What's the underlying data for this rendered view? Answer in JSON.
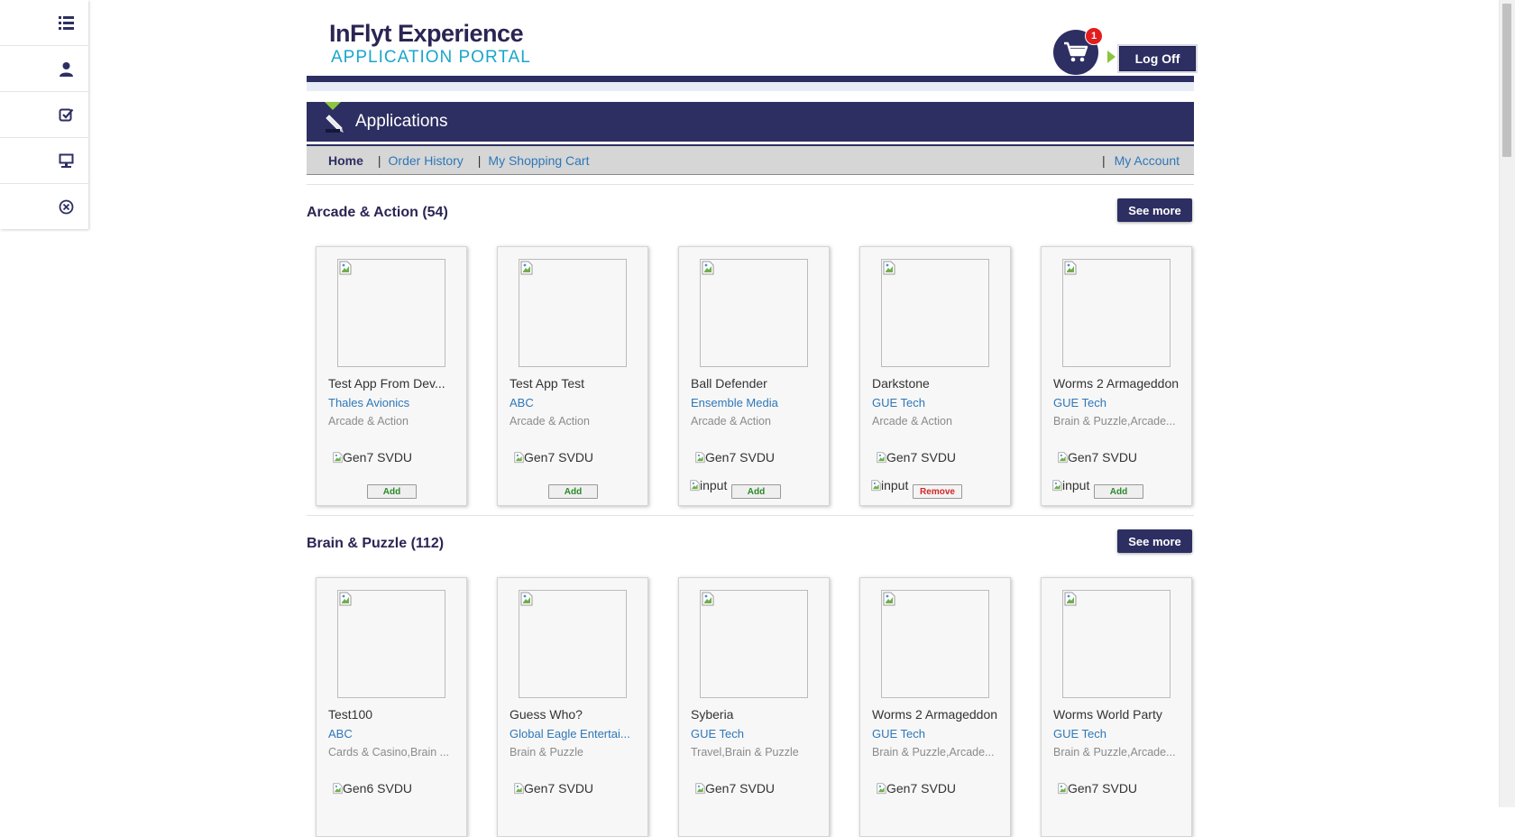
{
  "sidenav": {
    "items": [
      {
        "icon": "list-icon"
      },
      {
        "icon": "user-icon"
      },
      {
        "icon": "checkbox-icon"
      },
      {
        "icon": "monitor-icon"
      },
      {
        "icon": "close-circle-icon"
      }
    ]
  },
  "header": {
    "title": "InFlyt Experience",
    "subtitle": "APPLICATION PORTAL",
    "cart_count": "1",
    "logoff_label": "Log Off"
  },
  "apps_bar": {
    "title": "Applications"
  },
  "nav": {
    "home": "Home",
    "order_history": "Order History",
    "shopping_cart": "My Shopping Cart",
    "my_account": "My Account",
    "separator": "|"
  },
  "sections": [
    {
      "title": "Arcade & Action (54)",
      "see_more": "See more",
      "cards": [
        {
          "name": "Test App From Dev...",
          "developer": "Thales Avionics",
          "category": "Arcade & Action",
          "device": "Gen7 SVDU",
          "input": "",
          "button": "Add",
          "button_type": "add"
        },
        {
          "name": "Test App Test",
          "developer": "ABC",
          "category": "Arcade & Action",
          "device": "Gen7 SVDU",
          "input": "",
          "button": "Add",
          "button_type": "add"
        },
        {
          "name": "Ball Defender",
          "developer": "Ensemble Media",
          "category": "Arcade & Action",
          "device": "Gen7 SVDU",
          "input": "input",
          "button": "Add",
          "button_type": "add"
        },
        {
          "name": "Darkstone",
          "developer": "GUE Tech",
          "category": "Arcade & Action",
          "device": "Gen7 SVDU",
          "input": "input",
          "button": "Remove",
          "button_type": "remove"
        },
        {
          "name": "Worms 2 Armageddon",
          "developer": "GUE Tech",
          "category": "Brain & Puzzle,Arcade...",
          "device": "Gen7 SVDU",
          "input": "input",
          "button": "Add",
          "button_type": "add"
        }
      ]
    },
    {
      "title": "Brain & Puzzle (112)",
      "see_more": "See more",
      "cards": [
        {
          "name": "Test100",
          "developer": "ABC",
          "category": "Cards & Casino,Brain ...",
          "device": "Gen6 SVDU",
          "input": "",
          "button": "",
          "button_type": ""
        },
        {
          "name": "Guess Who?",
          "developer": "Global Eagle Entertai...",
          "category": "Brain & Puzzle",
          "device": "Gen7 SVDU",
          "input": "",
          "button": "",
          "button_type": ""
        },
        {
          "name": "Syberia",
          "developer": "GUE Tech",
          "category": "Travel,Brain & Puzzle",
          "device": "Gen7 SVDU",
          "input": "",
          "button": "",
          "button_type": ""
        },
        {
          "name": "Worms 2 Armageddon",
          "developer": "GUE Tech",
          "category": "Brain & Puzzle,Arcade...",
          "device": "Gen7 SVDU",
          "input": "",
          "button": "",
          "button_type": ""
        },
        {
          "name": "Worms World Party",
          "developer": "GUE Tech",
          "category": "Brain & Puzzle,Arcade...",
          "device": "Gen7 SVDU",
          "input": "",
          "button": "",
          "button_type": ""
        }
      ]
    }
  ],
  "colors": {
    "brand_navy": "#2d2f62",
    "brand_cyan": "#19a7c9",
    "accent_green": "#8cc53f",
    "link_blue": "#2e77b8",
    "badge_red": "#e31d1d"
  }
}
